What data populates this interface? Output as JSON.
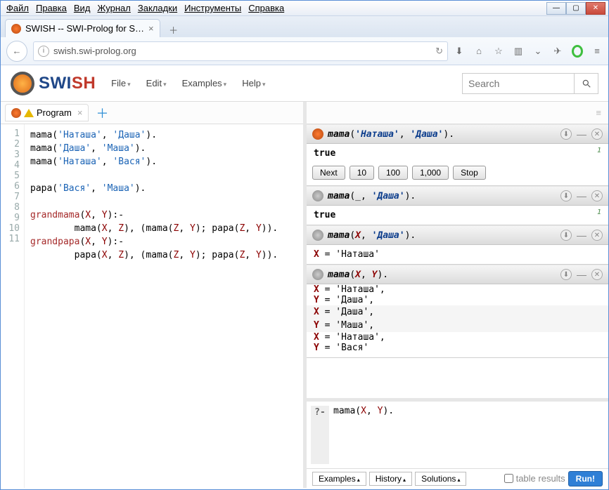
{
  "os_menu": [
    "Файл",
    "Правка",
    "Вид",
    "Журнал",
    "Закладки",
    "Инструменты",
    "Справка"
  ],
  "browser": {
    "tab_title": "SWISH -- SWI-Prolog for S…",
    "url": "swish.swi-prolog.org"
  },
  "app": {
    "logo_blue": "SWI",
    "logo_red": "SH",
    "menu": [
      "File",
      "Edit",
      "Examples",
      "Help"
    ],
    "search_placeholder": "Search"
  },
  "editor": {
    "tab_label": "Program",
    "lines": [
      {
        "n": 1,
        "html": "mama(<span class='str'>'Наташа'</span>, <span class='str'>'Даша'</span>)."
      },
      {
        "n": 2,
        "html": "mama(<span class='str'>'Даша'</span>, <span class='str'>'Маша'</span>)."
      },
      {
        "n": 3,
        "html": "mama(<span class='str'>'Наташа'</span>, <span class='str'>'Вася'</span>)."
      },
      {
        "n": 4,
        "html": ""
      },
      {
        "n": 5,
        "html": "papa(<span class='str'>'Вася'</span>, <span class='str'>'Маша'</span>)."
      },
      {
        "n": 6,
        "html": ""
      },
      {
        "n": 7,
        "html": "<span class='kw'>grandmama</span>(<span class='var'>X</span>, <span class='var'>Y</span>):-"
      },
      {
        "n": 8,
        "html": "        mama(<span class='var'>X</span>, <span class='var'>Z</span>), (mama(<span class='var'>Z</span>, <span class='var'>Y</span>); papa(<span class='var'>Z</span>, <span class='var'>Y</span>))."
      },
      {
        "n": 9,
        "html": "<span class='kw'>grandpapa</span>(<span class='var'>X</span>, <span class='var'>Y</span>):-"
      },
      {
        "n": 10,
        "html": "        papa(<span class='var'>X</span>, <span class='var'>Z</span>), (mama(<span class='var'>Z</span>, <span class='var'>Y</span>); papa(<span class='var'>Z</span>, <span class='var'>Y</span>))."
      },
      {
        "n": 11,
        "html": ""
      }
    ]
  },
  "answers": [
    {
      "icon": "color",
      "query_html": "<b><span class='q-name'>mama</span></b>(<span class='q-str'><b>'Наташа'</b></span>, <span class='q-str'><b>'Даша'</b></span>).",
      "result": "true",
      "idx": "1",
      "buttons": [
        "Next",
        "10",
        "100",
        "1,000",
        "Stop"
      ]
    },
    {
      "icon": "grey",
      "query_html": "<b><span class='q-name'>mama</span></b>(_, <span class='q-str'><b>'Даша'</b></span>).",
      "result": "true",
      "idx": "1"
    },
    {
      "icon": "grey",
      "query_html": "<b><span class='q-name'>mama</span></b>(<span class='q-var'><b>X</b></span>, <span class='q-str'><b>'Даша'</b></span>).",
      "bindings": [
        [
          "X",
          "'Наташа'"
        ]
      ]
    },
    {
      "icon": "grey",
      "query_html": "<b><span class='q-name'>mama</span></b>(<span class='q-var'><b>X</b></span>, <span class='q-var'><b>Y</b></span>).",
      "solutions": [
        [
          [
            "X",
            "'Наташа'"
          ],
          [
            "Y",
            "'Даша'"
          ]
        ],
        [
          [
            "X",
            "'Даша'"
          ],
          [
            "Y",
            "'Маша'"
          ]
        ],
        [
          [
            "X",
            "'Наташа'"
          ],
          [
            "Y",
            "'Вася'"
          ]
        ]
      ]
    }
  ],
  "query_pane": {
    "prompt": "?-",
    "text_html": "mama(<span class='var'>X</span>, <span class='var'>Y</span>).",
    "footer_btns": [
      "Examples",
      "History",
      "Solutions"
    ],
    "table_label": "table results",
    "run_label": "Run!"
  }
}
